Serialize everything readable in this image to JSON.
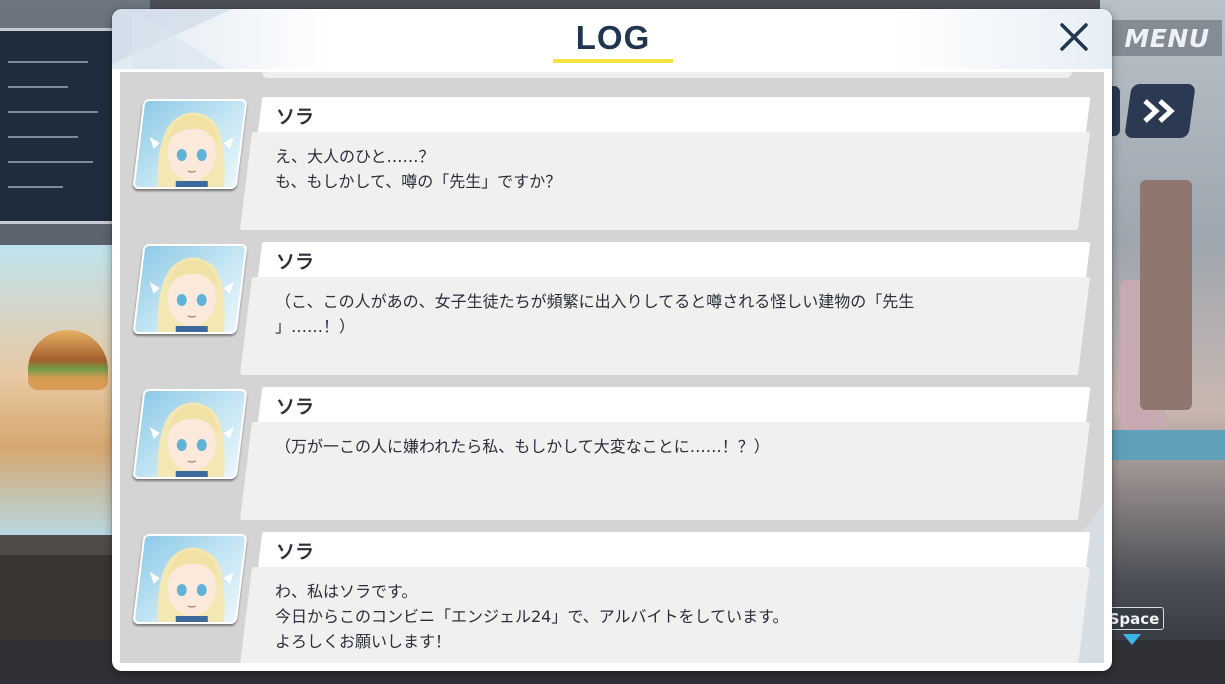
{
  "hud": {
    "menu_label": "MENU",
    "space_label": "Space"
  },
  "log": {
    "title": "LOG",
    "entries": [
      {
        "speaker": "ソラ",
        "text": "え、大人のひと……？\nも、もしかして、噂の「先生」ですか？"
      },
      {
        "speaker": "ソラ",
        "text": "（こ、この人があの、女子生徒たちが頻繁に出入りしてると噂される怪しい建物の「先生\n」……！）"
      },
      {
        "speaker": "ソラ",
        "text": "（万が一この人に嫌われたら私、もしかして大変なことに……！？）"
      },
      {
        "speaker": "ソラ",
        "text": "わ、私はソラです。\n今日からこのコンビニ「エンジェル24」で、アルバイトをしています。\nよろしくお願いします！"
      }
    ]
  },
  "colors": {
    "title": "#1f3550",
    "title_underline": "#f4e241",
    "space_arrow": "#3db4e6"
  },
  "icons": {
    "close": "close-icon",
    "fast_forward": "fast-forward-icon",
    "portrait": "character-portrait"
  }
}
